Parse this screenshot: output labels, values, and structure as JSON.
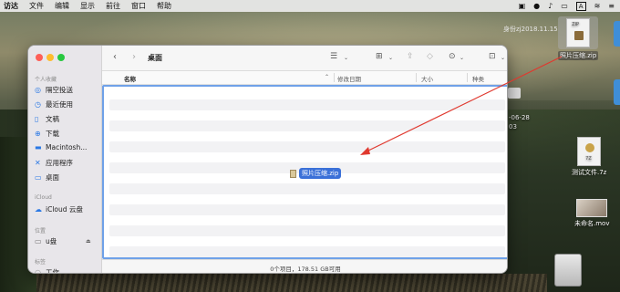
{
  "menubar": {
    "app": "访达",
    "items": [
      "文件",
      "编辑",
      "显示",
      "前往",
      "窗口",
      "帮助"
    ],
    "status_icons": [
      "wechat-icon",
      "qq-icon",
      "bell-icon",
      "display-icon",
      "input-A-icon",
      "wifi-icon",
      "controlcenter-icon"
    ],
    "input_label": "A"
  },
  "watermark": "身份zj2018.11.15",
  "window": {
    "title": "桌面",
    "sidebar": {
      "section_favorites": "个人收藏",
      "favorites": [
        "隔空投送",
        "最近使用",
        "文稿",
        "下载",
        "Macintosh...",
        "应用程序",
        "桌面"
      ],
      "section_icloud": "iCloud",
      "icloud": [
        "iCloud 云盘"
      ],
      "section_locations": "位置",
      "locations": [
        "u盘"
      ],
      "section_tags": "标签",
      "tags": [
        "工作"
      ]
    },
    "columns": {
      "name": "名称",
      "date": "修改日期",
      "size": "大小",
      "kind": "种类"
    },
    "status": "0个项目，178.51 GB可用",
    "drag_item": "照片压缩.zip"
  },
  "desktop": {
    "zip_file": {
      "label": "照片压缩.zip",
      "badge": "ZIP"
    },
    "sevenz_file": {
      "label": "测试文件.7z",
      "badge": "7Z"
    },
    "video_file": {
      "label": "未命名.mov"
    },
    "behind_date": "-06-28",
    "behind_num": "03"
  },
  "colors": {
    "accent": "#3a70d8",
    "arrow": "#e0382e",
    "selection_border": "#6fa1e8"
  }
}
